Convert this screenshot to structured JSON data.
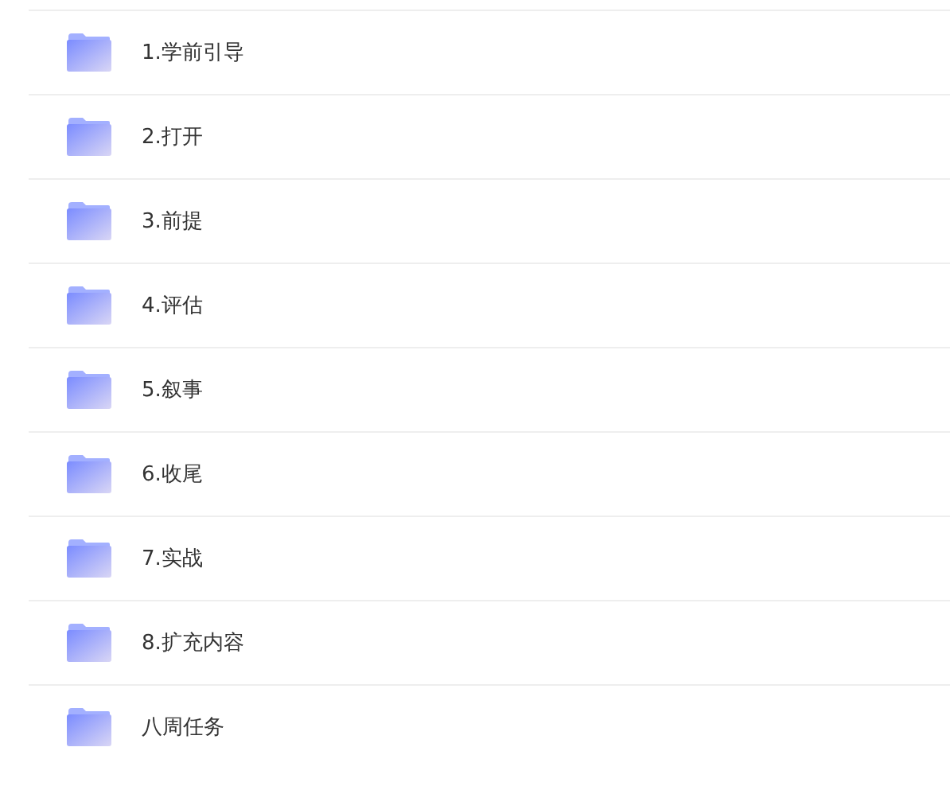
{
  "folders": [
    {
      "name": "1.学前引导"
    },
    {
      "name": "2.打开"
    },
    {
      "name": "3.前提"
    },
    {
      "name": "4.评估"
    },
    {
      "name": "5.叙事"
    },
    {
      "name": "6.收尾"
    },
    {
      "name": "7.实战"
    },
    {
      "name": "8.扩充内容"
    },
    {
      "name": "八周任务"
    }
  ]
}
